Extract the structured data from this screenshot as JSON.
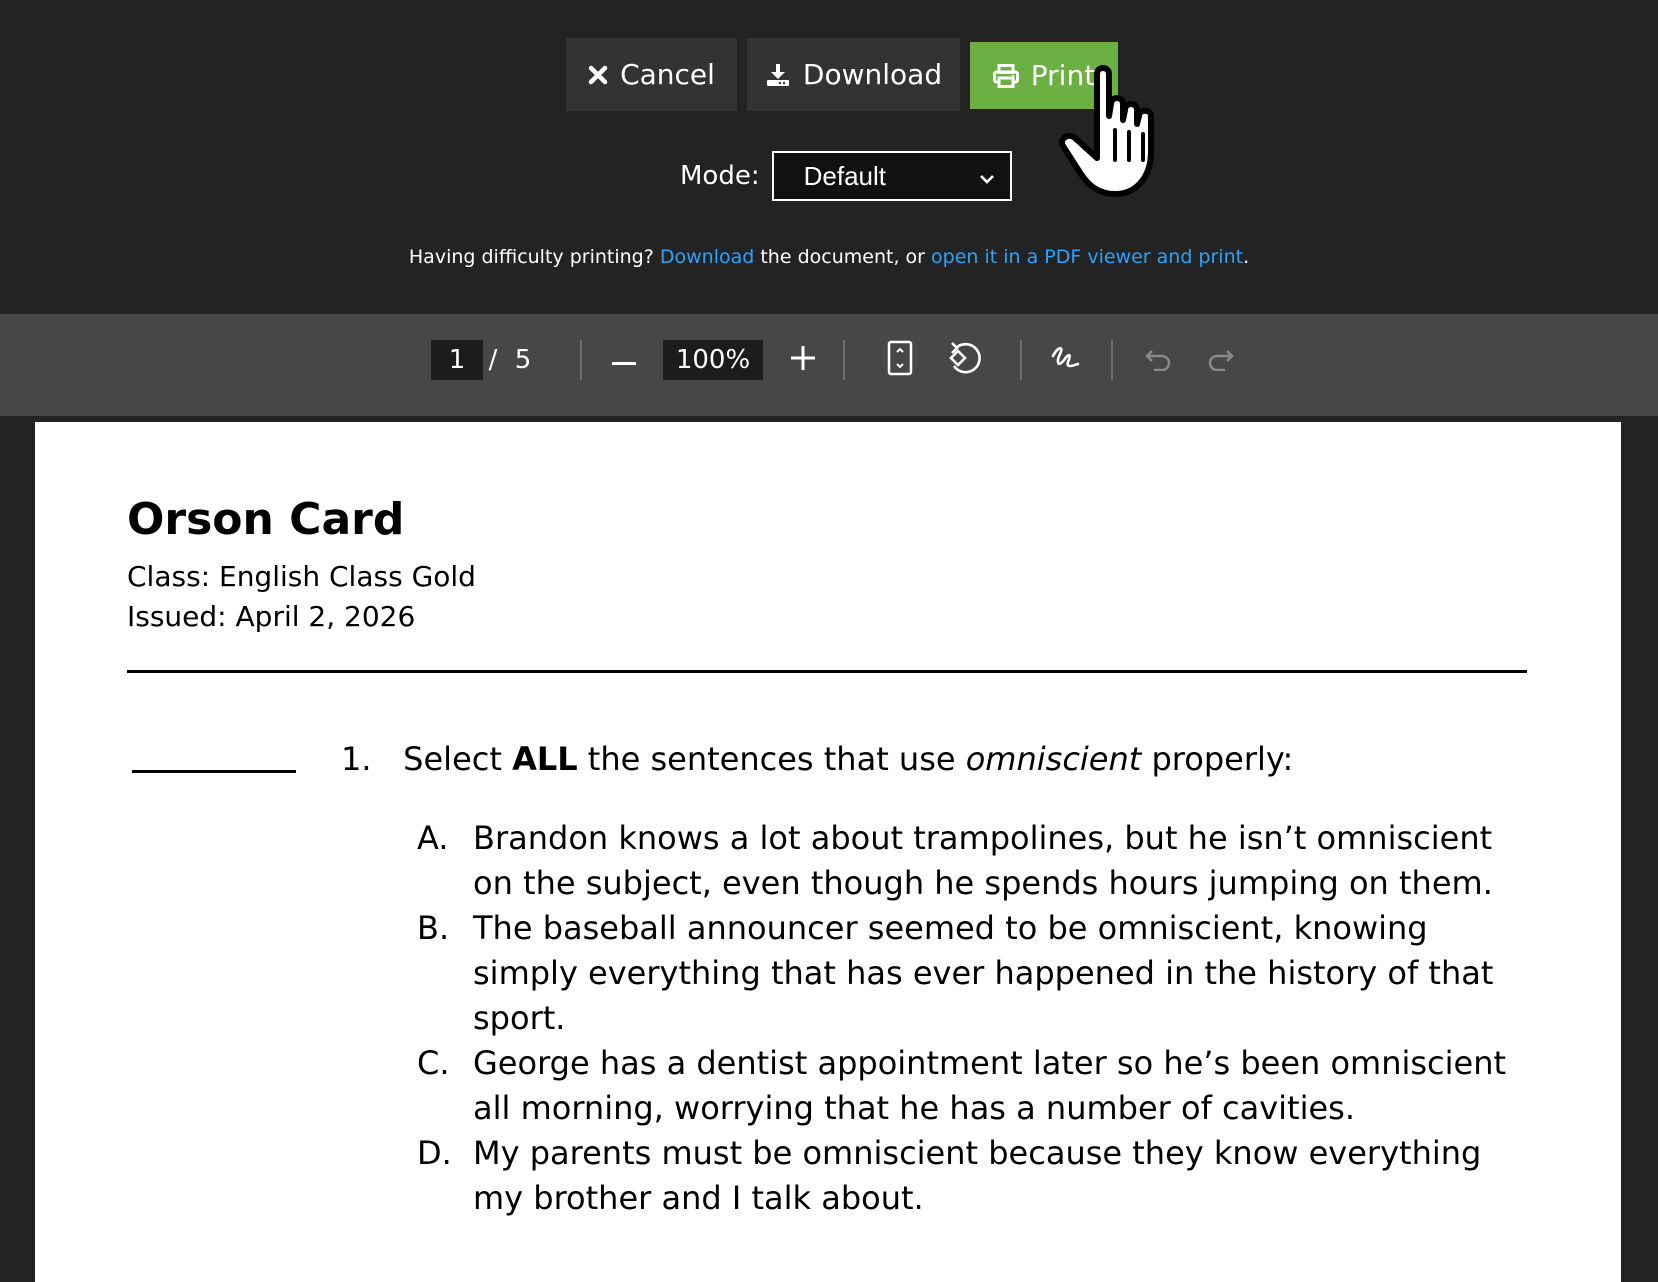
{
  "dialog": {
    "cancel_label": "Cancel",
    "download_label": "Download",
    "print_label": "Print",
    "mode_label": "Mode:",
    "mode_value": "Default",
    "help": {
      "prefix": "Having difficulty printing?",
      "link1": "Download",
      "middle": "the document, or",
      "link2": "open it in a PDF viewer and print",
      "suffix": "."
    },
    "colors": {
      "background": "#232323",
      "button": "#333333",
      "print": "#6cb043",
      "link": "#2aa4ff"
    }
  },
  "pdf_toolbar": {
    "page_current": "1",
    "page_separator": "/",
    "page_total": "5",
    "zoom": "100%",
    "icons": [
      "minus-icon",
      "plus-icon",
      "fit-page-icon",
      "rotate-icon",
      "draw-icon",
      "undo-icon",
      "redo-icon"
    ]
  },
  "document": {
    "name": "Orson Card",
    "class_line": "Class: English Class Gold",
    "issued_line": "Issued: April 2, 2026",
    "question": {
      "number": "1.",
      "text_before": "Select",
      "bold": "ALL",
      "text_middle": "the sentences that use",
      "italic": "omniscient",
      "text_after": "properly:"
    },
    "options": [
      {
        "letter": "A.",
        "text": "Brandon knows a lot about trampolines, but he isn’t omniscient on the subject, even though he spends hours jumping on them."
      },
      {
        "letter": "B.",
        "text": "The baseball announcer seemed to be omniscient, knowing simply everything that has ever happened in the history of that sport."
      },
      {
        "letter": "C.",
        "text": "George has a dentist appointment later so he’s been omniscient all morning, worrying that he has a number of cavities."
      },
      {
        "letter": "D.",
        "text": "My parents must be omniscient because they know everything my brother and I talk about."
      }
    ]
  }
}
